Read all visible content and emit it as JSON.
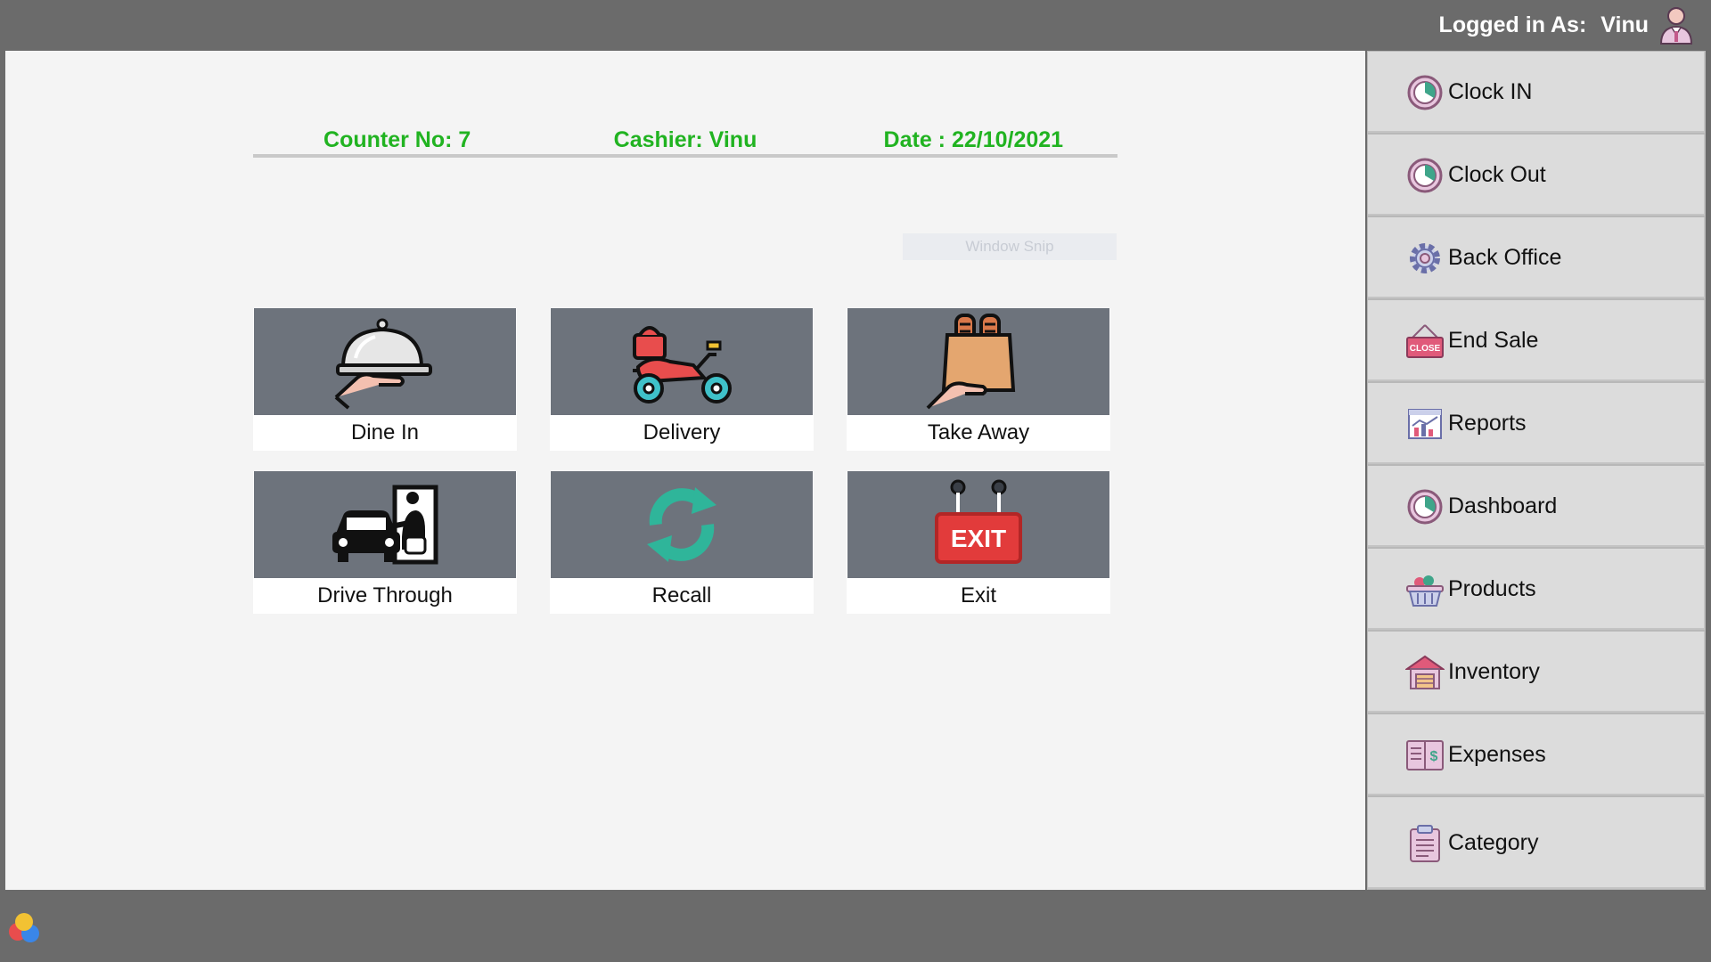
{
  "header": {
    "logged_in_label": "Logged in As:",
    "user_name": "Vinu"
  },
  "info": {
    "counter": "Counter No: 7",
    "cashier": "Cashier: Vinu",
    "date": "Date : 22/10/2021"
  },
  "snip_label": "Window Snip",
  "tiles": [
    {
      "label": "Dine In",
      "icon": "cloche-serving-icon"
    },
    {
      "label": "Delivery",
      "icon": "delivery-scooter-icon"
    },
    {
      "label": "Take Away",
      "icon": "takeaway-bag-icon"
    },
    {
      "label": "Drive Through",
      "icon": "drive-through-icon"
    },
    {
      "label": "Recall",
      "icon": "recall-arrows-icon"
    },
    {
      "label": "Exit",
      "icon": "exit-sign-icon"
    }
  ],
  "sidebar": {
    "items": [
      {
        "label": "Clock IN",
        "icon": "clock-icon"
      },
      {
        "label": "Clock Out",
        "icon": "clock-icon"
      },
      {
        "label": "Back Office",
        "icon": "gear-icon"
      },
      {
        "label": "End Sale",
        "icon": "close-sign-icon"
      },
      {
        "label": "Reports",
        "icon": "chart-icon"
      },
      {
        "label": "Dashboard",
        "icon": "clock-icon"
      },
      {
        "label": "Products",
        "icon": "basket-icon"
      },
      {
        "label": "Inventory",
        "icon": "warehouse-icon"
      },
      {
        "label": "Expenses",
        "icon": "ledger-icon"
      },
      {
        "label": "Category",
        "icon": "clipboard-icon"
      }
    ]
  },
  "colors": {
    "info_text": "#21b321",
    "tile_background": "#6d737c",
    "chrome": "#6b6b6b"
  }
}
